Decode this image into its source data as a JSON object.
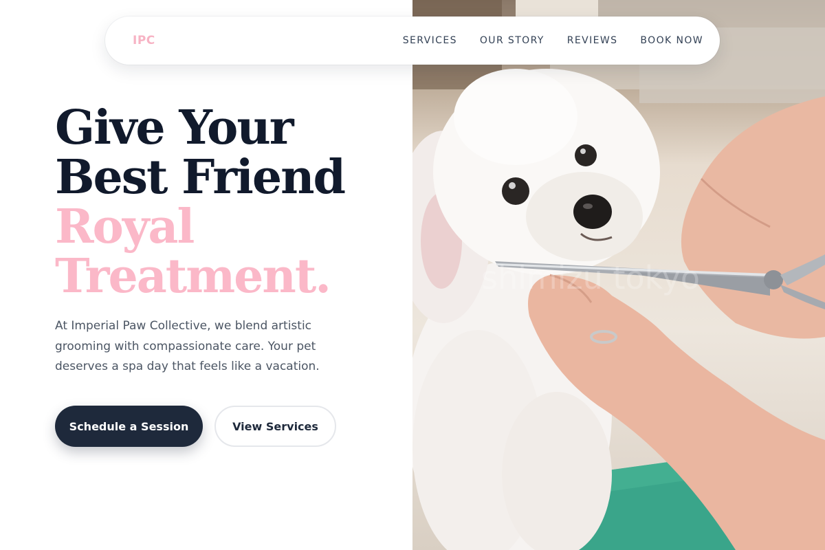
{
  "nav": {
    "brand": "IPC",
    "links": [
      {
        "label": "SERVICES"
      },
      {
        "label": "OUR STORY"
      },
      {
        "label": "REVIEWS"
      },
      {
        "label": "BOOK NOW"
      }
    ]
  },
  "hero": {
    "headline_line1": "Give Your",
    "headline_line2": "Best Friend",
    "headline_line3": "Royal",
    "headline_line4": "Treatment.",
    "description": "At Imperial Paw Collective, we blend artistic grooming with compassionate care. Your pet deserves a spa day that feels like a vacation.",
    "primary_cta": "Schedule a Session",
    "secondary_cta": "View Services"
  },
  "photo": {
    "subject": "white-poodle-being-groomed-with-scissors",
    "watermark": "shimizu tokyo"
  },
  "colors": {
    "brand_pink": "#fbb8c8",
    "navy": "#1e293b",
    "heading_dark": "#111a2c",
    "body_text": "#4b5563"
  }
}
